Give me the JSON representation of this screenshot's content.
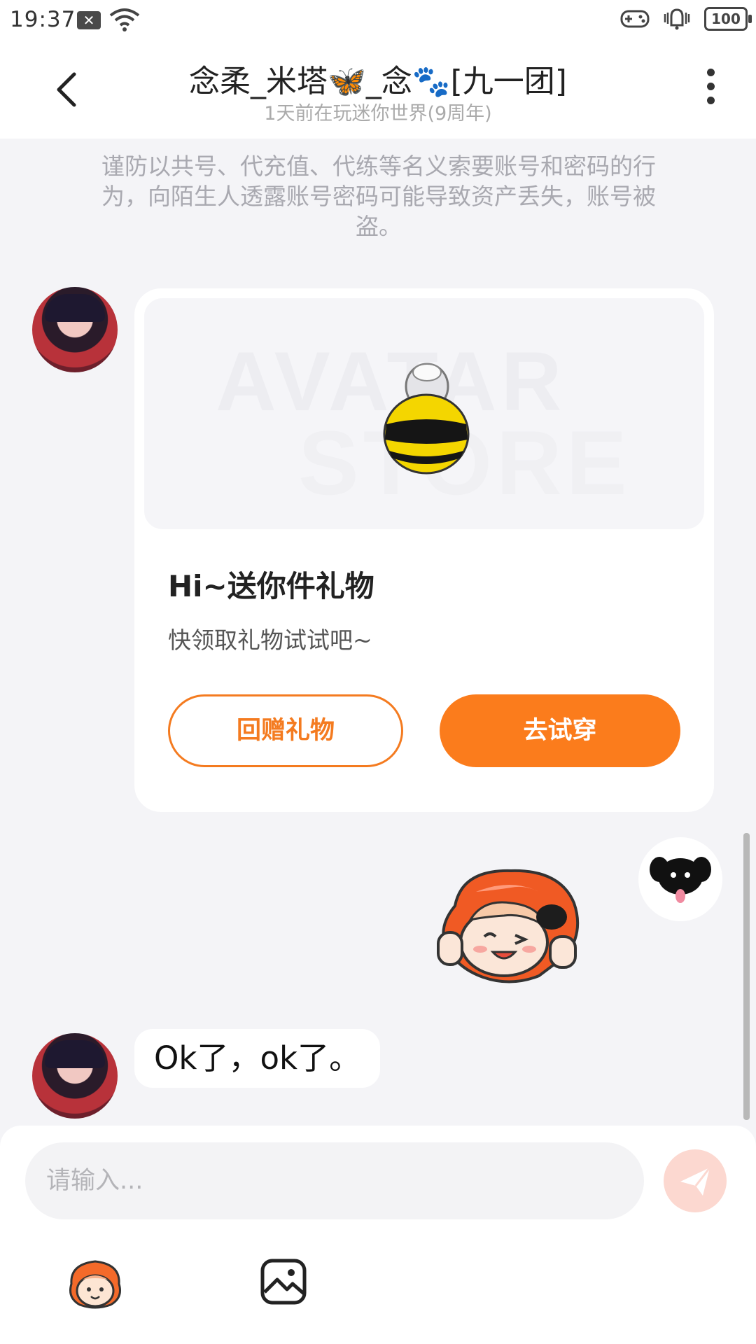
{
  "status_bar": {
    "time": "19:37",
    "battery": "100"
  },
  "header": {
    "title": "念柔_米塔🦋_念🐾[九一团]",
    "subtitle": "1天前在玩迷你世界(9周年)"
  },
  "notice": "谨防以共号、代充值、代练等名义索要账号和密码的行为，向陌生人透露账号密码可能导致资产丢失，账号被盗。",
  "gift_card": {
    "watermark_line1": "AVATAR",
    "watermark_line2": "STORE",
    "title": "Hi~送你件礼物",
    "description": "快领取礼物试试吧~",
    "return_button": "回赠礼物",
    "try_button": "去试穿"
  },
  "messages": [
    {
      "from": "friend",
      "type": "gift-card"
    },
    {
      "from": "me",
      "type": "sticker"
    },
    {
      "from": "friend",
      "type": "text",
      "text": "Ok了，ok了。"
    }
  ],
  "composer": {
    "placeholder": "请输入..."
  },
  "colors": {
    "accent": "#fb7c1c",
    "background": "#f4f4f7",
    "card": "#ffffff",
    "notice_text": "#a9a9b0"
  },
  "icons": [
    "back-arrow-icon",
    "more-vertical-icon",
    "send-icon",
    "emoji-mascot-icon",
    "image-icon",
    "wifi-icon",
    "gamepad-icon",
    "vibrate-icon"
  ]
}
